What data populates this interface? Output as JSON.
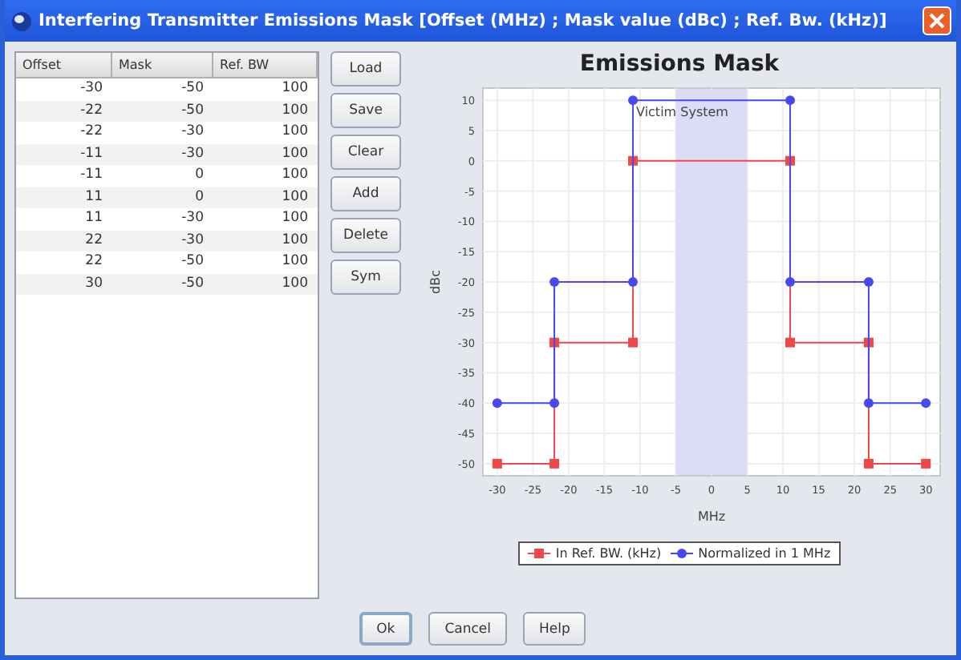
{
  "window": {
    "title": "Interfering Transmitter Emissions Mask [Offset (MHz) ; Mask value (dBc) ; Ref. Bw. (kHz)]"
  },
  "table": {
    "columns": [
      "Offset",
      "Mask",
      "Ref. BW"
    ],
    "rows": [
      [
        "-30",
        "-50",
        "100"
      ],
      [
        "-22",
        "-50",
        "100"
      ],
      [
        "-22",
        "-30",
        "100"
      ],
      [
        "-11",
        "-30",
        "100"
      ],
      [
        "-11",
        "0",
        "100"
      ],
      [
        "11",
        "0",
        "100"
      ],
      [
        "11",
        "-30",
        "100"
      ],
      [
        "22",
        "-30",
        "100"
      ],
      [
        "22",
        "-50",
        "100"
      ],
      [
        "30",
        "-50",
        "100"
      ]
    ]
  },
  "side_buttons": [
    "Load",
    "Save",
    "Clear",
    "Add",
    "Delete",
    "Sym"
  ],
  "chart": {
    "chart_data": {
      "type": "line",
      "title": "Emissions Mask",
      "xlabel": "MHz",
      "ylabel": "dBc",
      "x": [
        -30,
        -22,
        -22,
        -11,
        -11,
        11,
        11,
        22,
        22,
        30
      ],
      "series": [
        {
          "name": "In Ref. BW. (kHz)",
          "color": "#f04848",
          "marker": "square",
          "values": [
            -50,
            -50,
            -30,
            -30,
            0,
            0,
            -30,
            -30,
            -50,
            -50
          ]
        },
        {
          "name": "Normalized in 1 MHz",
          "color": "#4848f0",
          "marker": "circle",
          "values": [
            -40,
            -40,
            -20,
            -20,
            10,
            10,
            -20,
            -20,
            -40,
            -40
          ]
        }
      ],
      "xlim": [
        -32,
        32
      ],
      "ylim": [
        -52,
        12
      ],
      "xticks": [
        -30,
        -25,
        -20,
        -15,
        -10,
        -5,
        0,
        5,
        10,
        15,
        20,
        25,
        30
      ],
      "yticks": [
        -50,
        -45,
        -40,
        -35,
        -30,
        -25,
        -20,
        -15,
        -10,
        -5,
        0,
        5,
        10
      ],
      "grid": true,
      "bands": [
        {
          "axis": "x",
          "from": -5,
          "to": 5,
          "label": "Victim System"
        }
      ]
    }
  },
  "dialog_buttons": [
    {
      "label": "Ok",
      "focused": true
    },
    {
      "label": "Cancel",
      "focused": false
    },
    {
      "label": "Help",
      "focused": false
    }
  ]
}
